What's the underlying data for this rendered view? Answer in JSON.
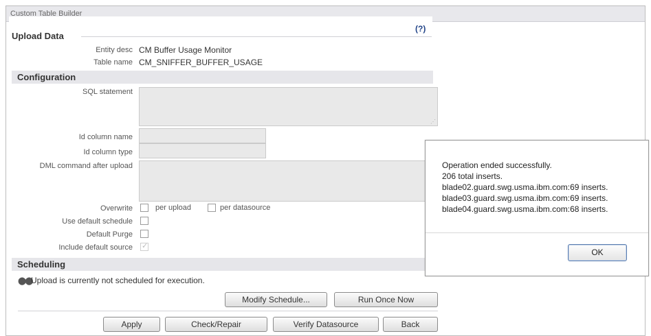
{
  "window": {
    "title": "Custom Table Builder"
  },
  "upload_data": {
    "title": "Upload Data",
    "help_label": "(?)",
    "entity_desc_label": "Entity desc",
    "entity_desc_value": "CM Buffer Usage Monitor",
    "table_name_label": "Table name",
    "table_name_value": "CM_SNIFFER_BUFFER_USAGE"
  },
  "configuration": {
    "title": "Configuration",
    "sql_statement_label": "SQL statement",
    "sql_statement_value": "",
    "id_column_name_label": "Id column name",
    "id_column_name_value": "",
    "id_column_type_label": "Id column type",
    "id_column_type_value": "",
    "dml_command_label": "DML command after upload",
    "dml_command_value": "",
    "overwrite_label": "Overwrite",
    "per_upload_label": "per upload",
    "per_datasource_label": "per datasource",
    "use_default_schedule_label": "Use default schedule",
    "default_purge_label": "Default Purge",
    "include_default_source_label": "Include default source",
    "include_default_source_checked": true
  },
  "scheduling": {
    "title": "Scheduling",
    "status": "Upload is currently not scheduled for execution.",
    "modify_schedule_label": "Modify Schedule...",
    "run_once_label": "Run Once Now"
  },
  "actions": {
    "apply_label": "Apply",
    "check_repair_label": "Check/Repair",
    "verify_datasource_label": "Verify Datasource",
    "back_label": "Back"
  },
  "dialog": {
    "line1": "Operation ended successfully.",
    "line2": "206 total inserts.",
    "line3": "blade02.guard.swg.usma.ibm.com:69 inserts.",
    "line4": "blade03.guard.swg.usma.ibm.com:69 inserts.",
    "line5": "blade04.guard.swg.usma.ibm.com:68 inserts.",
    "ok_label": "OK"
  }
}
